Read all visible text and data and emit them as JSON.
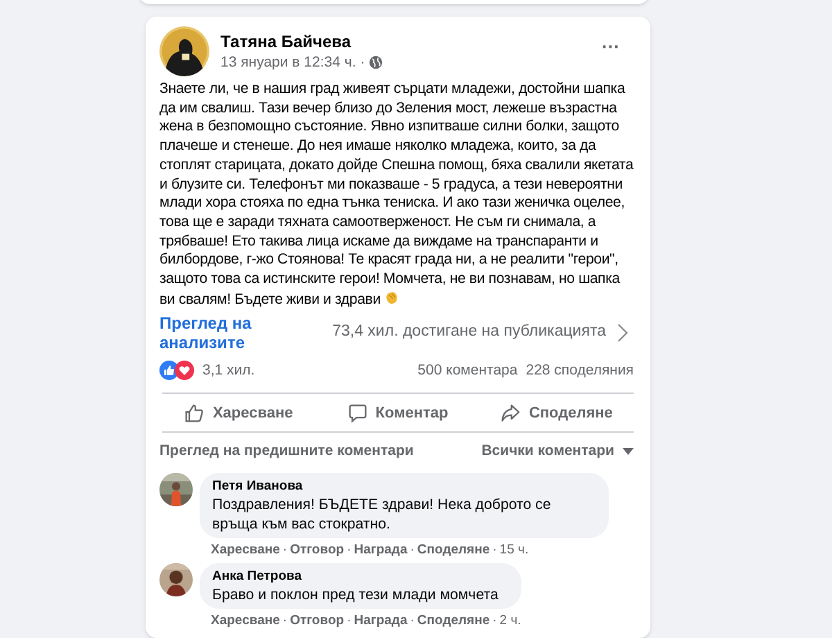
{
  "post": {
    "author": "Татяна Байчева",
    "time": "13 януари в 12:34 ч.",
    "separator": "·",
    "more": "···",
    "text": "Знаете ли, че в нашия град живеят сърцати младежи, достойни шапка да им свалиш. Тази вечер близо до Зеления мост, лежеше възрастна жена в безпомощно състояние. Явно изпитваше силни болки, защото плачеше и стенеше. До нея имаше няколко младежа, които, за да стоплят старицата, докато дойде Спешна помощ, бяха свалили якетата и блузите си. Телефонът ми показваше - 5 градуса, а тези невероятни млади хора стояха по една тънка тениска. И ако тази женичка оцелее, това ще е заради тяхната самоотверженост. Не съм ги снимала, а трябваше! Ето такива лица искаме да виждаме на транспаранти и билбордове, г-жо Стоянова! Те красят града ни, а не реалити \"герои\", защото това са истинските герои! Момчета, не ви познавам, но шапка ви свалям! Бъдете живи и здрави"
  },
  "insights": {
    "link": "Преглед на анализите",
    "reach": "73,4 хил. достигане на публикацията"
  },
  "stats": {
    "reactions": "3,1 хил.",
    "comments": "500 коментара",
    "shares": "228 споделяния"
  },
  "actions": [
    {
      "kind": "like",
      "label": "Харесване"
    },
    {
      "kind": "comment",
      "label": "Коментар"
    },
    {
      "kind": "share",
      "label": "Споделяне"
    }
  ],
  "comments_bar": {
    "previous": "Преглед на предишните коментари",
    "filter": "Всички коментари"
  },
  "comments": [
    {
      "author": "Петя Иванова",
      "text": "Поздравления! БЪДЕТЕ здрави! Нека доброто се връща към вас стократно.",
      "actions": [
        "Харесване",
        "Отговор",
        "Награда",
        "Споделяне"
      ],
      "separator": "·",
      "time": "15 ч."
    },
    {
      "author": "Анка Петрова",
      "text": "Браво и поклон пред тези млади момчета",
      "actions": [
        "Харесване",
        "Отговор",
        "Награда",
        "Споделяне"
      ],
      "separator": "·",
      "time": "2 ч."
    }
  ]
}
